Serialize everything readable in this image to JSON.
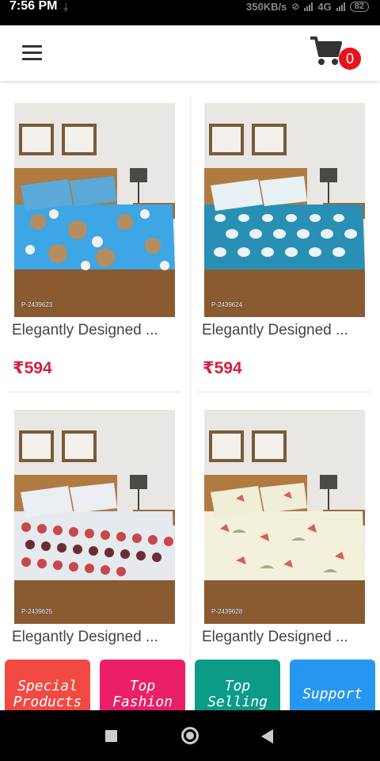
{
  "status_bar": {
    "time": "7:56 PM",
    "download_glyph": "⤓",
    "network_speed": "350KB/s",
    "network_type": "4G",
    "battery": "82"
  },
  "header": {
    "menu_icon": "hamburger-menu-icon",
    "cart_icon": "shopping-cart-icon",
    "cart_count": "0"
  },
  "products": [
    {
      "code": "P-2439623",
      "title": "Elegantly Designed ...",
      "price": "₹594"
    },
    {
      "code": "P-2439624",
      "title": "Elegantly Designed ...",
      "price": "₹594"
    },
    {
      "code": "P-2439625",
      "title": "Elegantly Designed ..."
    },
    {
      "code": "P-2439628",
      "title": "Elegantly Designed ..."
    }
  ],
  "categories": [
    {
      "line1": "Special",
      "line2": "Products",
      "color": "#f24a43"
    },
    {
      "line1": "Top",
      "line2": "Fashion",
      "color": "#ea1f68"
    },
    {
      "line1": "Top",
      "line2": "Selling",
      "color": "#0b9b87"
    },
    {
      "line1": "Support",
      "line2": "",
      "color": "#2796f0"
    }
  ],
  "colors": {
    "price": "#d6203c",
    "badge": "#e8141d"
  }
}
